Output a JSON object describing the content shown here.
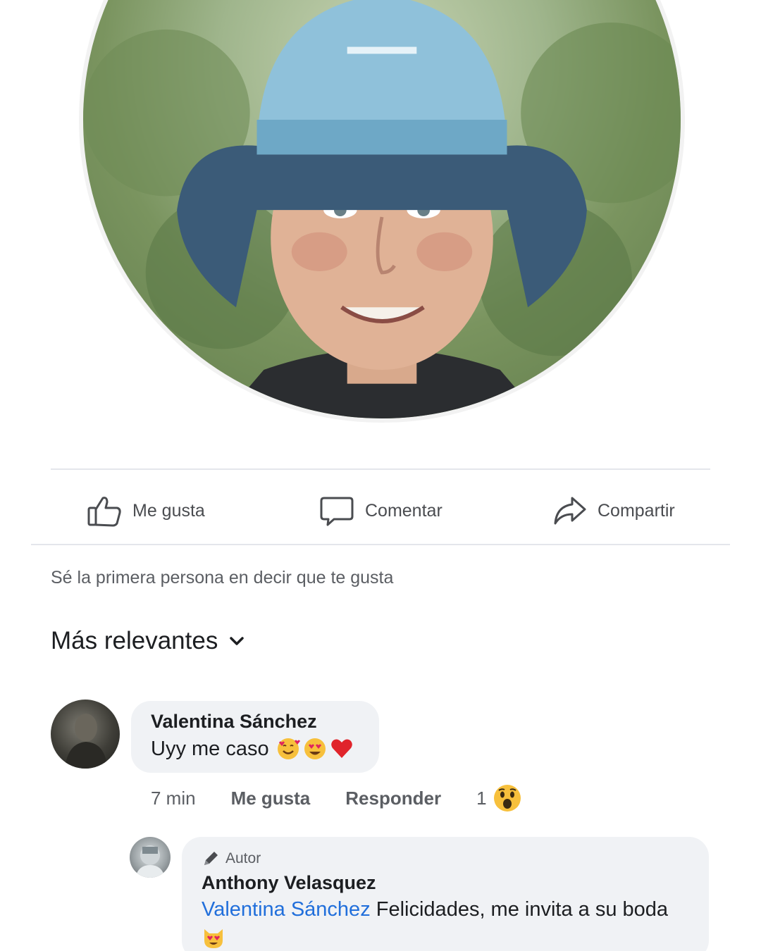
{
  "actions": {
    "like_label": "Me gusta",
    "comment_label": "Comentar",
    "share_label": "Compartir"
  },
  "likes_prompt": "Sé la primera persona en decir que te gusta",
  "sort": {
    "label": "Más relevantes"
  },
  "comments": [
    {
      "author": "Valentina Sánchez",
      "text": "Uyy me caso",
      "emojis": [
        "smiling-face-with-hearts",
        "heart-eyes",
        "red-heart"
      ],
      "time": "7 min",
      "like_label": "Me gusta",
      "reply_label": "Responder",
      "reaction_count": "1",
      "reaction_icon": "wow-reaction"
    }
  ],
  "reply": {
    "badge": "Autor",
    "author": "Anthony Velasquez",
    "mention": "Valentina Sánchez",
    "text": " Felicidades, me invita a su boda",
    "emoji": "heart-eyes-cat"
  },
  "colors": {
    "mention": "#216fdb",
    "bubble": "#f0f2f5",
    "divider": "#e4e6eb"
  }
}
